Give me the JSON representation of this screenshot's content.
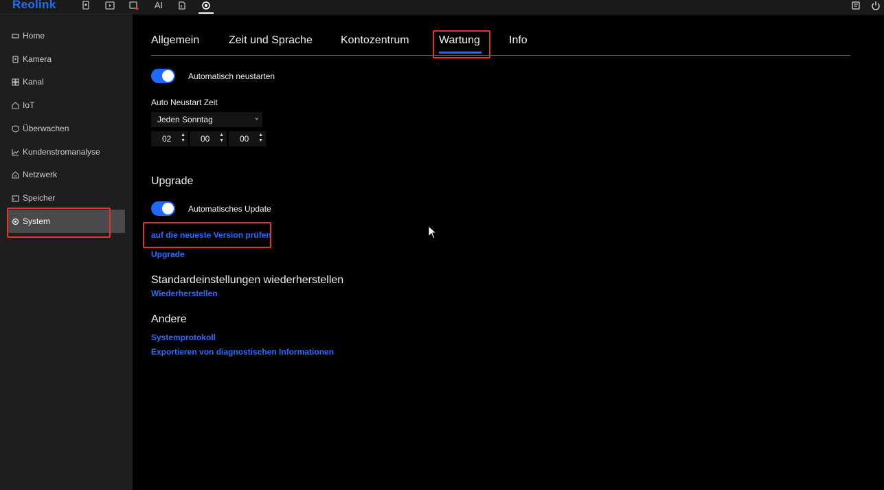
{
  "app": {
    "logo": "Reolink"
  },
  "topbar": {
    "icons": [
      "camera-icon",
      "playback-icon",
      "alarm-icon",
      "ai-icon",
      "files-icon",
      "settings-icon"
    ],
    "ai_label": "AI",
    "right_icons": [
      "message-icon",
      "power-icon"
    ]
  },
  "sidebar": {
    "items": [
      {
        "label": "Home",
        "icon": "home-icon"
      },
      {
        "label": "Kamera",
        "icon": "camera-icon"
      },
      {
        "label": "Kanal",
        "icon": "grid-icon"
      },
      {
        "label": "IoT",
        "icon": "house-icon"
      },
      {
        "label": "Überwachen",
        "icon": "shield-icon"
      },
      {
        "label": "Kundenstromanalyse",
        "icon": "chart-icon"
      },
      {
        "label": "Netzwerk",
        "icon": "network-icon"
      },
      {
        "label": "Speicher",
        "icon": "storage-icon"
      },
      {
        "label": "System",
        "icon": "settings-icon",
        "active": true
      }
    ]
  },
  "tabs": [
    {
      "label": "Allgemein"
    },
    {
      "label": "Zeit und Sprache"
    },
    {
      "label": "Kontozentrum"
    },
    {
      "label": "Wartung",
      "active": true
    },
    {
      "label": "Info"
    }
  ],
  "maintenance": {
    "auto_restart_label": "Automatisch neustarten",
    "auto_restart_on": true,
    "restart_time_label": "Auto Neustart Zeit",
    "restart_day": "Jeden Sonntag",
    "hour": "02",
    "minute": "00",
    "second": "00"
  },
  "upgrade": {
    "title": "Upgrade",
    "auto_update_label": "Automatisches Update",
    "auto_update_on": true,
    "check_link": "auf die neueste Version prüfen",
    "upgrade_link": "Upgrade"
  },
  "restore": {
    "title": "Standardeinstellungen wiederherstellen",
    "link": "Wiederherstellen"
  },
  "other": {
    "title": "Andere",
    "syslog_link": "Systemprotokoll",
    "export_link": "Exportieren von diagnostischen Informationen"
  },
  "colors": {
    "accent": "#1f6bff",
    "highlight_box": "#e0342c",
    "sidebar_bg": "#1e1e1e",
    "main_bg": "#000000"
  }
}
